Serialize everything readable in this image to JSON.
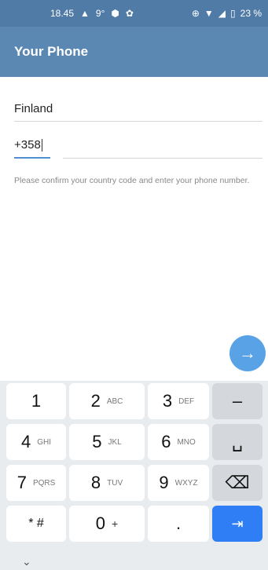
{
  "status": {
    "time": "18.45",
    "temp": "9°",
    "battery": "23 %"
  },
  "appbar": {
    "title": "Your Phone"
  },
  "form": {
    "country": "Finland",
    "code": "+358",
    "hint": "Please confirm your country code and enter your phone number."
  },
  "fab": {
    "icon": "→"
  },
  "keyboard": {
    "rows": [
      [
        {
          "n": "1",
          "s": ""
        },
        {
          "n": "2",
          "s": "ABC"
        },
        {
          "n": "3",
          "s": "DEF"
        },
        {
          "n": "–",
          "s": ""
        }
      ],
      [
        {
          "n": "4",
          "s": "GHI"
        },
        {
          "n": "5",
          "s": "JKL"
        },
        {
          "n": "6",
          "s": "MNO"
        },
        {
          "n": "␣",
          "s": ""
        }
      ],
      [
        {
          "n": "7",
          "s": "PQRS"
        },
        {
          "n": "8",
          "s": "TUV"
        },
        {
          "n": "9",
          "s": "WXYZ"
        },
        {
          "n": "⌫",
          "s": ""
        }
      ],
      [
        {
          "n": "* #",
          "s": ""
        },
        {
          "n": "0",
          "s": "+"
        },
        {
          "n": ".",
          "s": ""
        },
        {
          "n": "⇥",
          "s": ""
        }
      ]
    ],
    "collapse_icon": "⌄"
  }
}
